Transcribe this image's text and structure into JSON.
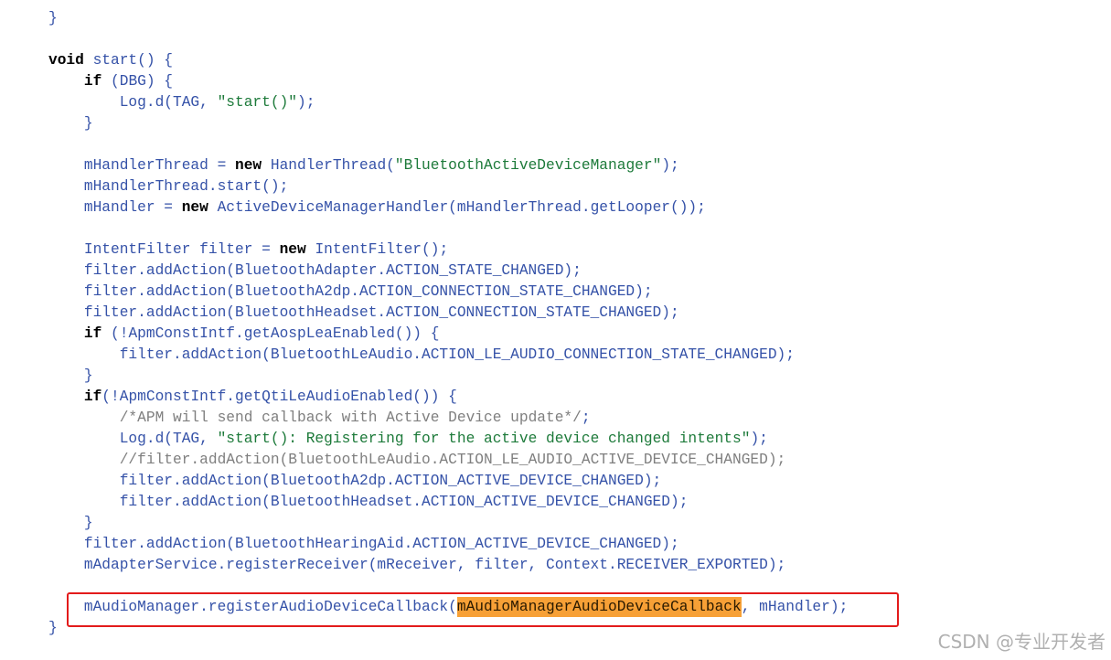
{
  "colors": {
    "background": "#ffffff",
    "text": "#3552a8",
    "keyword": "#000000",
    "string": "#1d7a3a",
    "comment": "#7f7f7f",
    "highlight_bg": "#f7a036",
    "highlight_text": "#2a1a00",
    "annotation_border": "#e31b1b",
    "watermark": "#b0b0b0"
  },
  "code": {
    "language": "java",
    "lines": [
      [
        {
          "t": "}",
          "c": "p"
        }
      ],
      [],
      [
        {
          "t": "void",
          "c": "k"
        },
        {
          "t": " start() {",
          "c": "p"
        }
      ],
      [
        {
          "t": "    ",
          "c": "p"
        },
        {
          "t": "if",
          "c": "k"
        },
        {
          "t": " (DBG) {",
          "c": "p"
        }
      ],
      [
        {
          "t": "        Log.d(TAG, ",
          "c": "p"
        },
        {
          "t": "\"start()\"",
          "c": "s"
        },
        {
          "t": ");",
          "c": "p"
        }
      ],
      [
        {
          "t": "    }",
          "c": "p"
        }
      ],
      [],
      [
        {
          "t": "    mHandlerThread = ",
          "c": "p"
        },
        {
          "t": "new",
          "c": "k"
        },
        {
          "t": " HandlerThread(",
          "c": "p"
        },
        {
          "t": "\"BluetoothActiveDeviceManager\"",
          "c": "s"
        },
        {
          "t": ");",
          "c": "p"
        }
      ],
      [
        {
          "t": "    mHandlerThread.start();",
          "c": "p"
        }
      ],
      [
        {
          "t": "    mHandler = ",
          "c": "p"
        },
        {
          "t": "new",
          "c": "k"
        },
        {
          "t": " ActiveDeviceManagerHandler(mHandlerThread.getLooper());",
          "c": "p"
        }
      ],
      [],
      [
        {
          "t": "    IntentFilter filter = ",
          "c": "p"
        },
        {
          "t": "new",
          "c": "k"
        },
        {
          "t": " IntentFilter();",
          "c": "p"
        }
      ],
      [
        {
          "t": "    filter.addAction(BluetoothAdapter.ACTION_STATE_CHANGED);",
          "c": "p"
        }
      ],
      [
        {
          "t": "    filter.addAction(BluetoothA2dp.ACTION_CONNECTION_STATE_CHANGED);",
          "c": "p"
        }
      ],
      [
        {
          "t": "    filter.addAction(BluetoothHeadset.ACTION_CONNECTION_STATE_CHANGED);",
          "c": "p"
        }
      ],
      [
        {
          "t": "    ",
          "c": "p"
        },
        {
          "t": "if",
          "c": "k"
        },
        {
          "t": " (!ApmConstIntf.getAospLeaEnabled()) {",
          "c": "p"
        }
      ],
      [
        {
          "t": "        filter.addAction(BluetoothLeAudio.ACTION_LE_AUDIO_CONNECTION_STATE_CHANGED);",
          "c": "p"
        }
      ],
      [
        {
          "t": "    }",
          "c": "p"
        }
      ],
      [
        {
          "t": "    ",
          "c": "p"
        },
        {
          "t": "if",
          "c": "k"
        },
        {
          "t": "(!ApmConstIntf.getQtiLeAudioEnabled()) {",
          "c": "p"
        }
      ],
      [
        {
          "t": "        ",
          "c": "p"
        },
        {
          "t": "/*APM will send callback with Active Device update*/",
          "c": "m"
        },
        {
          "t": ";",
          "c": "p"
        }
      ],
      [
        {
          "t": "        Log.d(TAG, ",
          "c": "p"
        },
        {
          "t": "\"start(): Registering for the active device changed intents\"",
          "c": "s"
        },
        {
          "t": ");",
          "c": "p"
        }
      ],
      [
        {
          "t": "        ",
          "c": "p"
        },
        {
          "t": "//filter.addAction(BluetoothLeAudio.ACTION_LE_AUDIO_ACTIVE_DEVICE_CHANGED);",
          "c": "m"
        }
      ],
      [
        {
          "t": "        filter.addAction(BluetoothA2dp.ACTION_ACTIVE_DEVICE_CHANGED);",
          "c": "p"
        }
      ],
      [
        {
          "t": "        filter.addAction(BluetoothHeadset.ACTION_ACTIVE_DEVICE_CHANGED);",
          "c": "p"
        }
      ],
      [
        {
          "t": "    }",
          "c": "p"
        }
      ],
      [
        {
          "t": "    filter.addAction(BluetoothHearingAid.ACTION_ACTIVE_DEVICE_CHANGED);",
          "c": "p"
        }
      ],
      [
        {
          "t": "    mAdapterService.registerReceiver(mReceiver, filter, Context.RECEIVER_EXPORTED);",
          "c": "p"
        }
      ],
      [],
      [
        {
          "t": "    mAudioManager.registerAudioDeviceCallback(",
          "c": "p"
        },
        {
          "t": "mAudioManagerAudioDeviceCallback",
          "c": "h"
        },
        {
          "t": ", mHandler);",
          "c": "p"
        }
      ],
      [
        {
          "t": "}",
          "c": "p"
        }
      ]
    ]
  },
  "watermark": {
    "text": "CSDN @专业开发者"
  }
}
